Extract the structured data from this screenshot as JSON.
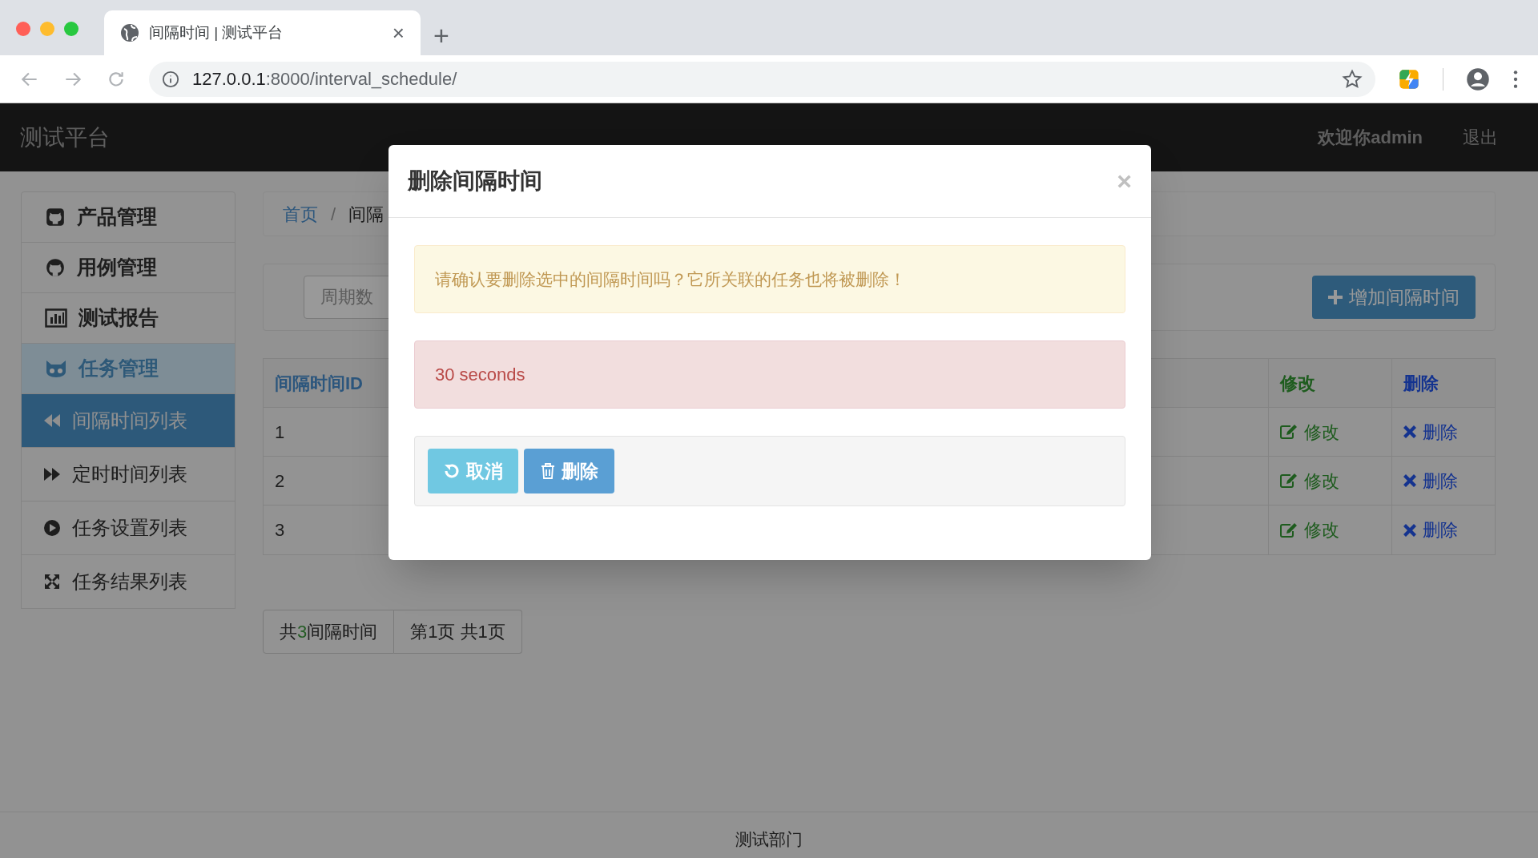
{
  "browser": {
    "tab_title": "间隔时间 | 测试平台",
    "tab_close": "×",
    "new_tab": "+",
    "url_host": "127.0.0.1",
    "url_rest": ":8000/interval_schedule/"
  },
  "navbar": {
    "brand": "测试平台",
    "welcome": "欢迎你admin",
    "logout": "退出"
  },
  "sidebar": {
    "items": [
      {
        "label": "产品管理",
        "expanded": false
      },
      {
        "label": "用例管理",
        "expanded": false
      },
      {
        "label": "测试报告",
        "expanded": false
      },
      {
        "label": "任务管理",
        "expanded": true,
        "children": [
          {
            "label": "间隔时间列表",
            "selected": true
          },
          {
            "label": "定时时间列表",
            "selected": false
          },
          {
            "label": "任务设置列表",
            "selected": false
          },
          {
            "label": "任务结果列表",
            "selected": false
          }
        ]
      }
    ]
  },
  "breadcrumb": [
    "首页",
    "间隔"
  ],
  "breadcrumb_separator": "/",
  "search": {
    "placeholder": "周期数"
  },
  "add_button": "增加间隔时间",
  "table": {
    "columns": [
      "间隔时间ID",
      "修改",
      "删除"
    ],
    "rows": [
      {
        "id": "1",
        "edit": "修改",
        "delete": "删除"
      },
      {
        "id": "2",
        "edit": "修改",
        "delete": "删除"
      },
      {
        "id": "3",
        "edit": "修改",
        "delete": "删除"
      }
    ]
  },
  "pagination": {
    "total_prefix": "共",
    "total_count": "3",
    "total_suffix": "间隔时间",
    "page": "第1页 共1页"
  },
  "footer": "测试部门",
  "modal": {
    "title": "删除间隔时间",
    "close": "×",
    "warning": "请确认要删除选中的间隔时间吗？它所关联的任务也将被删除！",
    "item": "30 seconds",
    "cancel": "取消",
    "delete": "删除"
  }
}
